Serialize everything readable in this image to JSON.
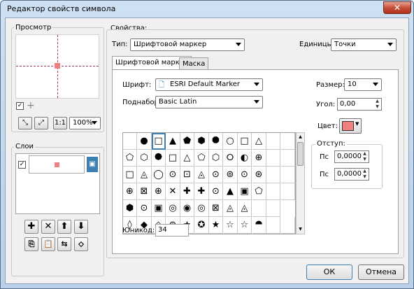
{
  "window": {
    "title": "Редактор свойств символа",
    "close_glyph": "✕"
  },
  "preview": {
    "label": "Просмотр",
    "zoom_value": "100%",
    "toolbar_icons": [
      "zoom-in-icon",
      "zoom-fit-icon",
      "actual-size-icon"
    ]
  },
  "layers": {
    "label": "Слои"
  },
  "properties": {
    "label": "Свойства:",
    "type_label": "Тип:",
    "type_value": "Шрифтовой маркер",
    "units_label": "Единицы:",
    "units_value": "Точки"
  },
  "tabs": [
    {
      "label": "Шрифтовой маркер",
      "active": true
    },
    {
      "label": "Маска",
      "active": false
    }
  ],
  "font": {
    "label": "Шрифт:",
    "value": "ESRI Default Marker"
  },
  "subset": {
    "label": "Поднабор:",
    "value": "Basic Latin"
  },
  "size": {
    "label": "Размер:",
    "value": "10"
  },
  "angle": {
    "label": "Угол:",
    "value": "0,00"
  },
  "color": {
    "label": "Цвет:",
    "value": "#f08080"
  },
  "offset": {
    "label": "Отступ:",
    "x_label": "Пс",
    "x_value": "0,0000",
    "y_label": "Пс",
    "y_value": "0,0000"
  },
  "unicode": {
    "label": "Юникод:",
    "value": "34"
  },
  "glyphs": [
    [
      "",
      "●",
      "□",
      "▲",
      "⬟",
      "⬢",
      "⯃",
      "○",
      "□",
      "△",
      "",
      ""
    ],
    [
      "⬠",
      "⬡",
      "⯄",
      "□",
      "△",
      "⬠",
      "⬡",
      "⭘",
      "◐",
      "⊕",
      "",
      ""
    ],
    [
      "□",
      "◬",
      "◯",
      "⊙",
      "⊡",
      "◬",
      "⊙",
      "⊚",
      "⊙",
      "⊛",
      "",
      ""
    ],
    [
      "⊕",
      "⊠",
      "⊕",
      "✕",
      "✚",
      "✚",
      "⊙",
      "▲",
      "▣",
      "⬠",
      "",
      ""
    ],
    [
      "⬢",
      "⊙",
      "▣",
      "◎",
      "◉",
      "◎",
      "⊠",
      "◬",
      "◬",
      "",
      ""
    ],
    [
      "◊",
      "◆",
      "◇",
      "⊛",
      "★",
      "✪",
      "★",
      "☆",
      "☆",
      "⯊",
      "",
      ""
    ]
  ],
  "buttons": {
    "ok": "ОК",
    "cancel": "Отмена"
  }
}
